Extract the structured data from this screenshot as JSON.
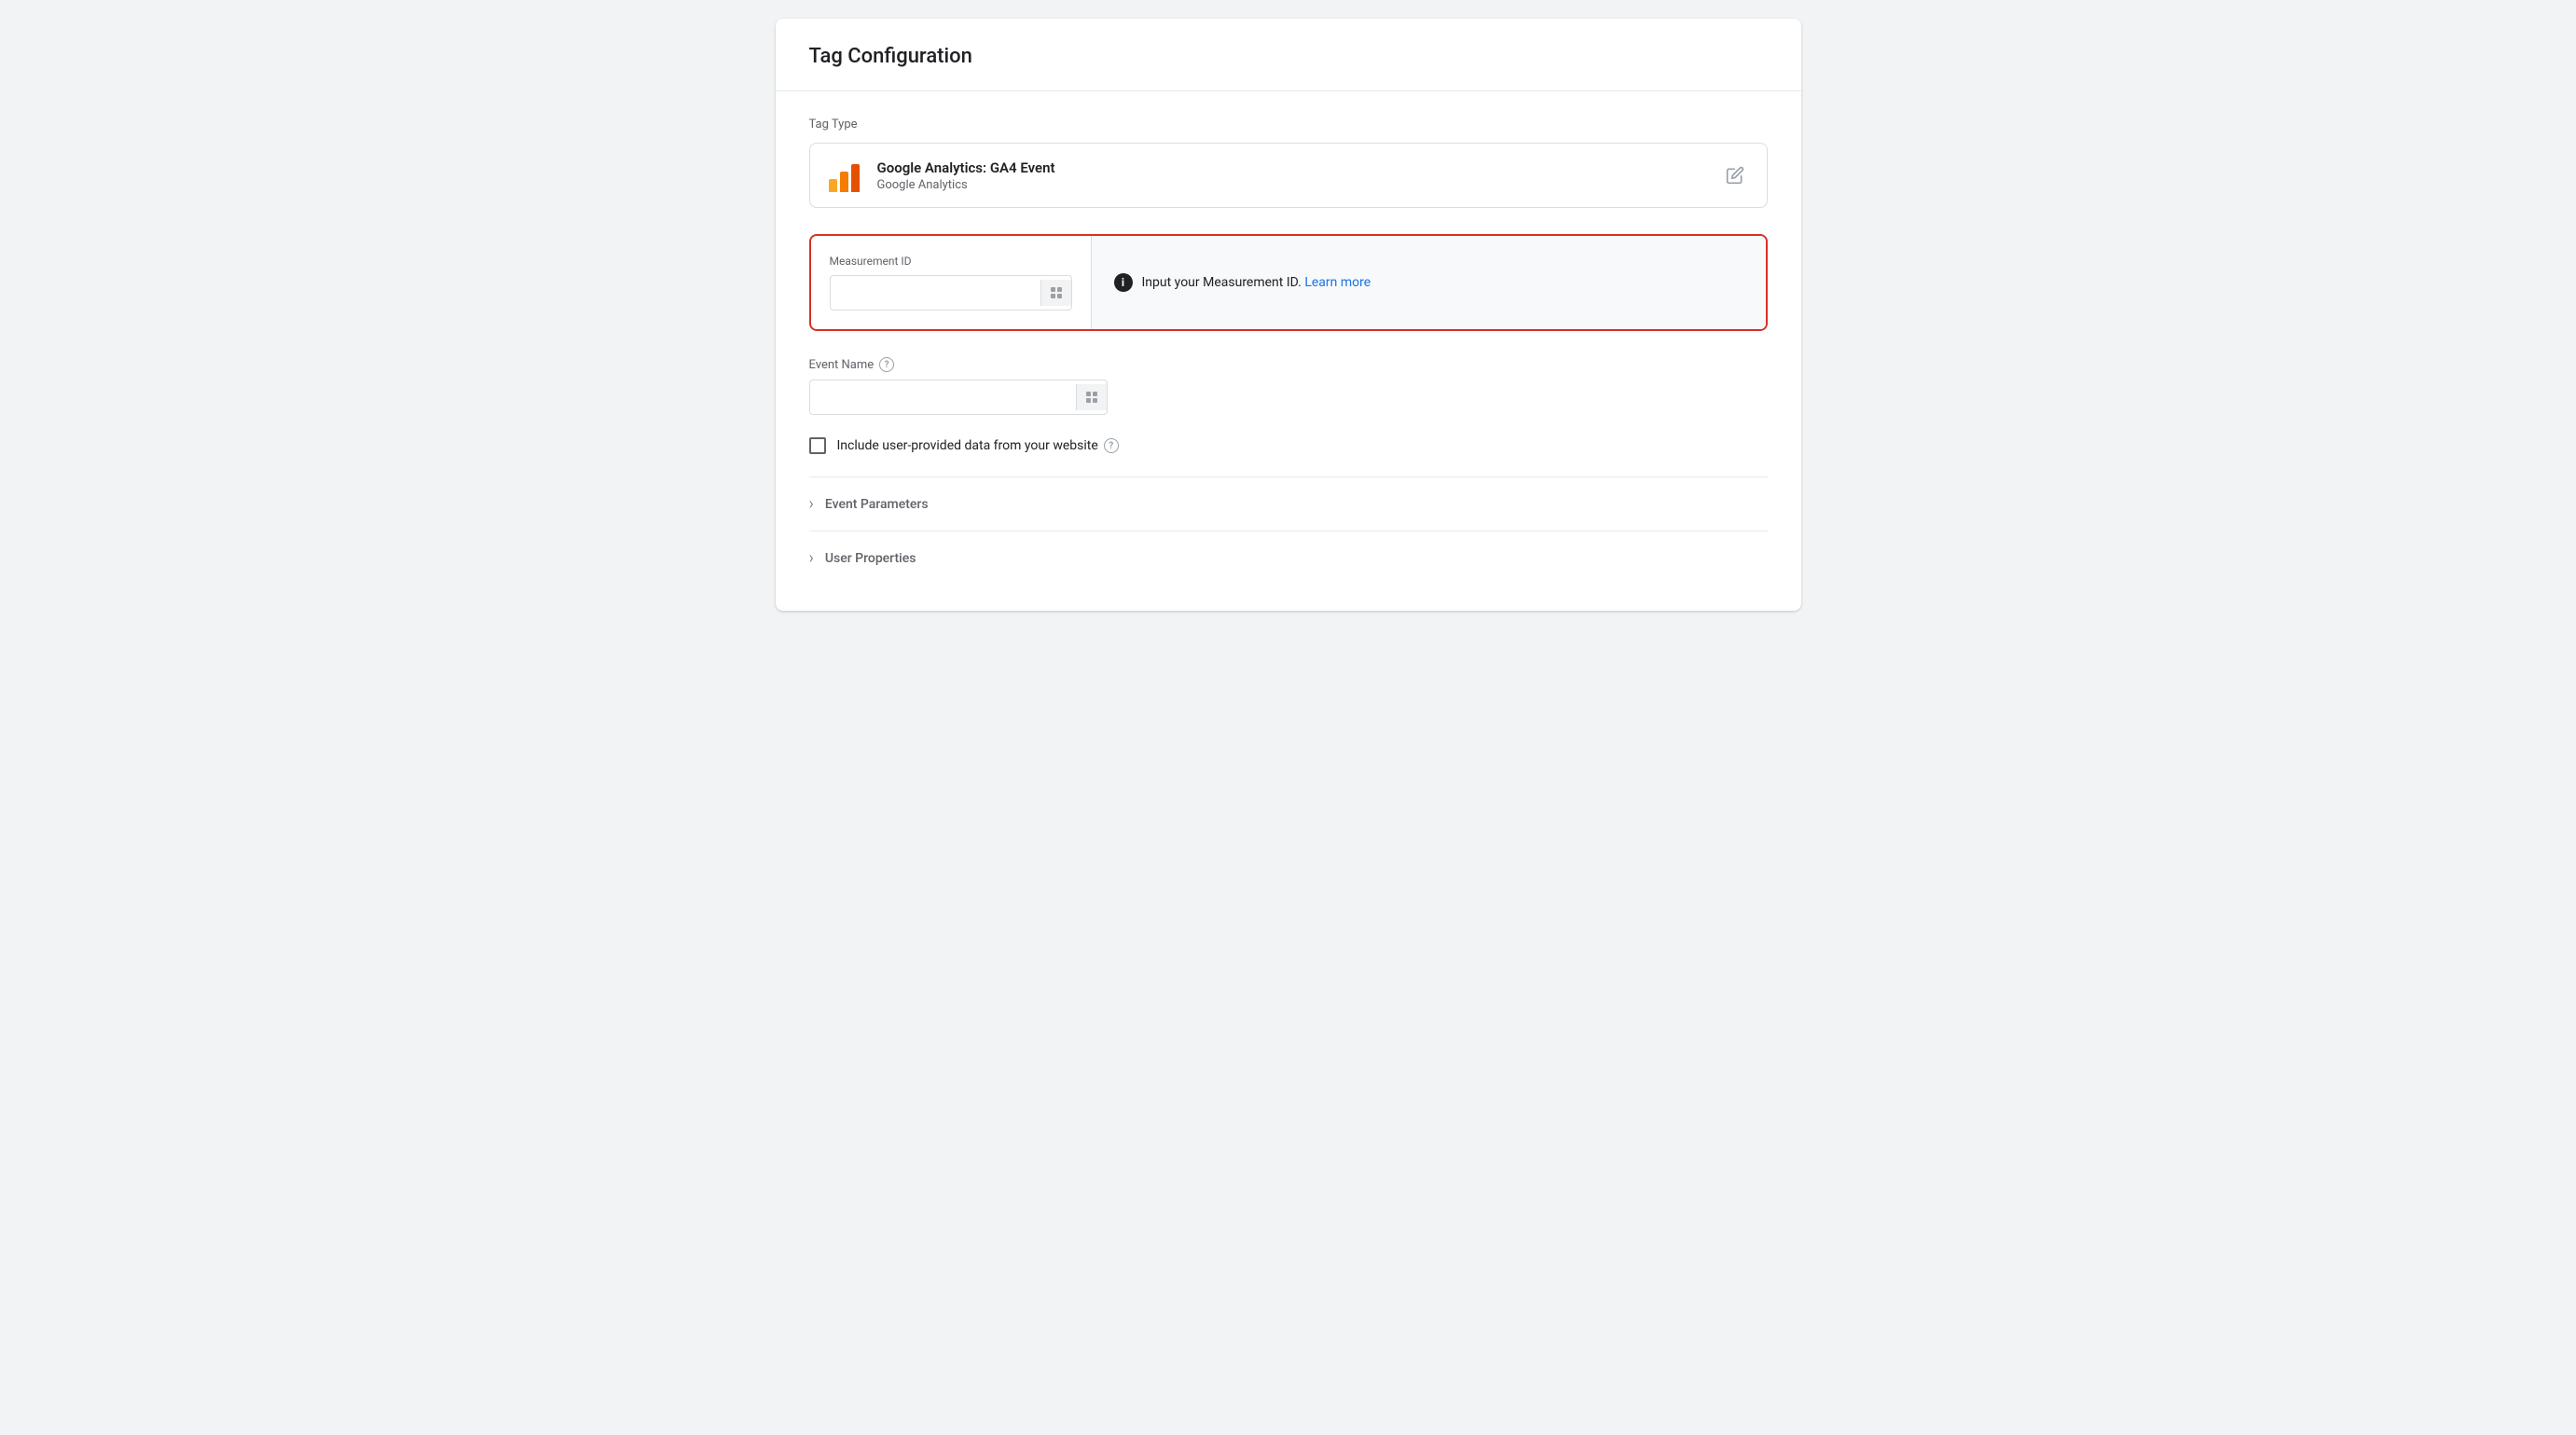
{
  "panel": {
    "title": "Tag Configuration"
  },
  "tagType": {
    "label": "Tag Type",
    "name": "Google Analytics: GA4 Event",
    "provider": "Google Analytics",
    "editIcon": "✏"
  },
  "measurementId": {
    "fieldLabel": "Measurement ID",
    "inputValue": "",
    "inputPlaceholder": "",
    "infoText": "Input your Measurement ID.",
    "learnMoreText": "Learn more",
    "learnMoreUrl": "#"
  },
  "eventName": {
    "fieldLabel": "Event Name",
    "inputValue": "",
    "inputPlaceholder": ""
  },
  "userDataCheckbox": {
    "label": "Include user-provided data from your website",
    "checked": false
  },
  "collapsibleSections": [
    {
      "label": "Event Parameters"
    },
    {
      "label": "User Properties"
    }
  ]
}
